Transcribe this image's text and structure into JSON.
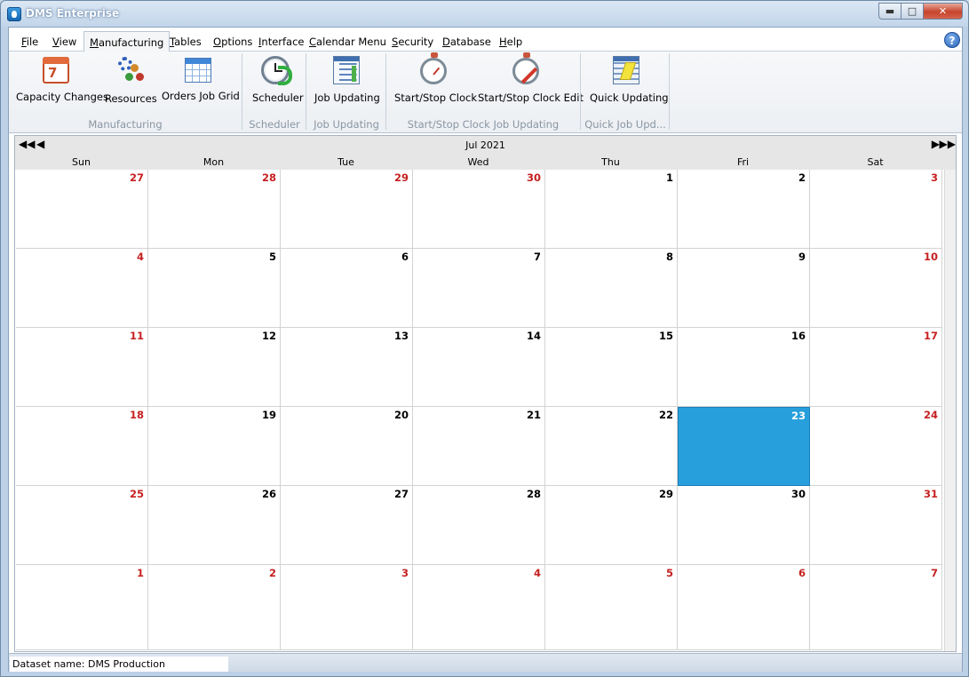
{
  "window": {
    "title": "DMS Enterprise"
  },
  "menu": {
    "items": [
      {
        "label": "File",
        "u": "F",
        "rest": "ile"
      },
      {
        "label": "View",
        "u": "V",
        "rest": "iew"
      },
      {
        "label": "Manufacturing",
        "u": "M",
        "rest": "anufacturing"
      },
      {
        "label": "Tables",
        "u": "T",
        "rest": "ables"
      },
      {
        "label": "Options",
        "u": "O",
        "rest": "ptions"
      },
      {
        "label": "Interface",
        "u": "I",
        "rest": "nterface"
      },
      {
        "label": "Calendar Menu",
        "u": "C",
        "rest": "alendar Menu"
      },
      {
        "label": "Security",
        "u": "S",
        "rest": "ecurity"
      },
      {
        "label": "Database",
        "u": "D",
        "rest": "atabase"
      },
      {
        "label": "Help",
        "u": "H",
        "rest": "elp"
      }
    ]
  },
  "ribbon": {
    "buttons": [
      {
        "label": "Capacity Changes",
        "icon": "calendar-icon",
        "glyph": "7"
      },
      {
        "label": "Resources",
        "icon": "resources-icon"
      },
      {
        "label": "Orders Job Grid",
        "icon": "grid-icon"
      },
      {
        "label": "Scheduler",
        "icon": "scheduler-clock-icon"
      },
      {
        "label": "Job Updating",
        "icon": "document-icon"
      },
      {
        "label": "Start/Stop Clock",
        "icon": "stopwatch-icon"
      },
      {
        "label": "Start/Stop Clock Edit",
        "icon": "stopwatch-edit-icon"
      },
      {
        "label": "Quick Updating",
        "icon": "quick-update-icon"
      }
    ],
    "groups": [
      "Manufacturing",
      "Scheduler",
      "Job Updating",
      "Start/Stop Clock Job Updating",
      "Quick Job Upd..."
    ]
  },
  "calendar": {
    "month_label": "Jul 2021",
    "weekdays": [
      "Sun",
      "Mon",
      "Tue",
      "Wed",
      "Thu",
      "Fri",
      "Sat"
    ],
    "weeks": [
      [
        {
          "d": "27",
          "red": true
        },
        {
          "d": "28",
          "red": true
        },
        {
          "d": "29",
          "red": true
        },
        {
          "d": "30",
          "red": true
        },
        {
          "d": "1"
        },
        {
          "d": "2"
        },
        {
          "d": "3",
          "red": true
        }
      ],
      [
        {
          "d": "4",
          "red": true
        },
        {
          "d": "5"
        },
        {
          "d": "6"
        },
        {
          "d": "7"
        },
        {
          "d": "8"
        },
        {
          "d": "9"
        },
        {
          "d": "10",
          "red": true
        }
      ],
      [
        {
          "d": "11",
          "red": true
        },
        {
          "d": "12"
        },
        {
          "d": "13"
        },
        {
          "d": "14"
        },
        {
          "d": "15"
        },
        {
          "d": "16"
        },
        {
          "d": "17",
          "red": true
        }
      ],
      [
        {
          "d": "18",
          "red": true
        },
        {
          "d": "19"
        },
        {
          "d": "20"
        },
        {
          "d": "21"
        },
        {
          "d": "22"
        },
        {
          "d": "23",
          "selected": true
        },
        {
          "d": "24",
          "red": true
        }
      ],
      [
        {
          "d": "25",
          "red": true
        },
        {
          "d": "26"
        },
        {
          "d": "27"
        },
        {
          "d": "28"
        },
        {
          "d": "29"
        },
        {
          "d": "30"
        },
        {
          "d": "31",
          "red": true
        }
      ],
      [
        {
          "d": "1",
          "red": true
        },
        {
          "d": "2",
          "red": true
        },
        {
          "d": "3",
          "red": true
        },
        {
          "d": "4",
          "red": true
        },
        {
          "d": "5",
          "red": true
        },
        {
          "d": "6",
          "red": true
        },
        {
          "d": "7",
          "red": true
        }
      ]
    ],
    "colors": {
      "selected": "#279fdc",
      "weekend": "#c62020"
    }
  },
  "status": {
    "dataset_label": "Dataset name:  DMS Production"
  }
}
